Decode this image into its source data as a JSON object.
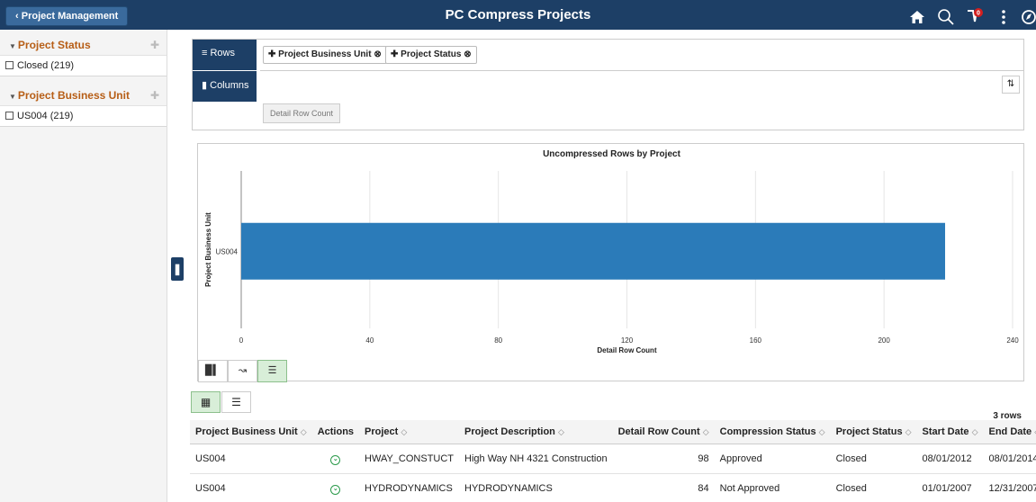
{
  "header": {
    "back_label": "Project Management",
    "title": "PC Compress Projects",
    "icons": [
      "home-icon",
      "search-icon",
      "notifications-icon",
      "more-icon",
      "navbar-icon"
    ],
    "notification_count": "0"
  },
  "facets": [
    {
      "title": "Project Status",
      "items": [
        {
          "label": "Closed (219)"
        }
      ]
    },
    {
      "title": "Project Business Unit",
      "items": [
        {
          "label": "US004 (219)"
        }
      ]
    }
  ],
  "pivot": {
    "rows_label": "Rows",
    "columns_label": "Columns",
    "row_fields": [
      "Project Business Unit",
      "Project Status"
    ],
    "value_button": "Detail Row Count"
  },
  "chart_data": {
    "type": "bar",
    "orientation": "horizontal",
    "title": "Uncompressed Rows by Project",
    "xlabel": "Detail Row Count",
    "ylabel": "Project Business Unit",
    "categories": [
      "US004"
    ],
    "values": [
      219
    ],
    "xlim": [
      0,
      240
    ],
    "xticks": [
      0,
      40,
      80,
      120,
      160,
      200,
      240
    ],
    "grid": true,
    "color": "#2b7bb9"
  },
  "grid": {
    "row_count": "3 rows",
    "columns": [
      "Project Business Unit",
      "Actions",
      "Project",
      "Project Description",
      "Detail Row Count",
      "Compression Status",
      "Project Status",
      "Start Date",
      "End Date"
    ],
    "rows": [
      {
        "bu": "US004",
        "project": "HWAY_CONSTUCT",
        "desc": "High Way NH 4321 Construction",
        "count": "98",
        "comp": "Approved",
        "status": "Closed",
        "start": "08/01/2012",
        "end": "08/01/2014"
      },
      {
        "bu": "US004",
        "project": "HYDRODYNAMICS",
        "desc": "HYDRODYNAMICS",
        "count": "84",
        "comp": "Not Approved",
        "status": "Closed",
        "start": "01/01/2007",
        "end": "12/31/2007"
      }
    ]
  }
}
